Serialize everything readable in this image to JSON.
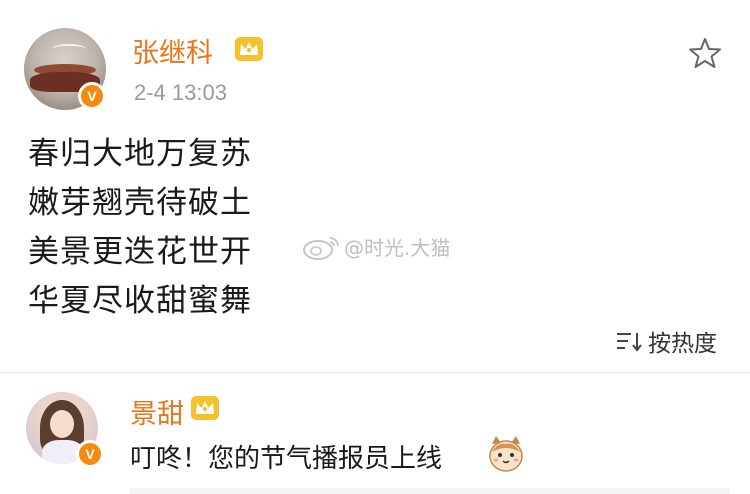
{
  "post": {
    "author": "张继科",
    "timestamp": "2-4 13:03",
    "verified_badge": "V",
    "verified_color": "#f68a11",
    "username_color": "#e8751a",
    "poem_lines": [
      "春归大地万复苏",
      "嫩芽翘壳待破土",
      "美景更迭花世开",
      "华夏尽收甜蜜舞"
    ],
    "watermark": "@时光.大猫",
    "favorite_icon": "star-outline-icon"
  },
  "sort": {
    "label": "按热度",
    "icon": "sort-icon"
  },
  "comment": {
    "author": "景甜",
    "verified_badge": "V",
    "text": "叮咚！您的节气播报员上线",
    "emoji": "cat-emoji-icon"
  }
}
